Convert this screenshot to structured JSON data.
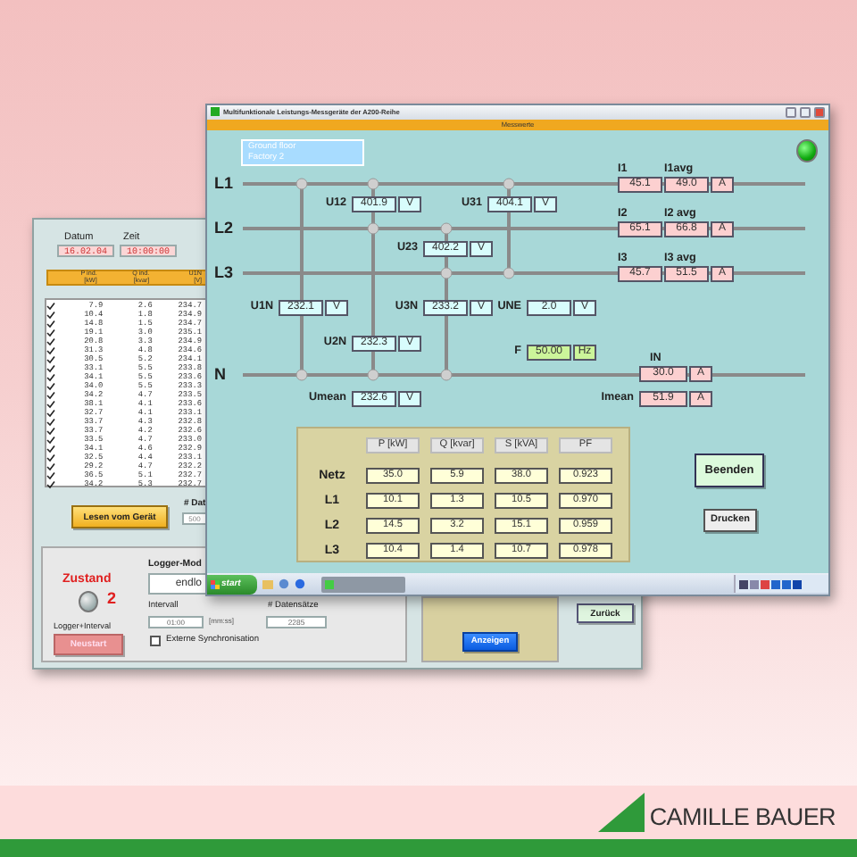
{
  "logger_window": {
    "date_label": "Datum",
    "time_label": "Zeit",
    "date": "16.02.04",
    "time": "10:00:00",
    "columns": [
      {
        "name": "P ind.",
        "unit": "[kW]"
      },
      {
        "name": "Q ind.",
        "unit": "[kvar]"
      },
      {
        "name": "U1N",
        "unit": "[V]"
      }
    ],
    "rows": [
      {
        "checked": true,
        "values": [
          "7.9",
          "2.6",
          "234.7"
        ]
      },
      {
        "checked": true,
        "values": [
          "10.4",
          "1.8",
          "234.9"
        ]
      },
      {
        "checked": true,
        "values": [
          "14.8",
          "1.5",
          "234.7"
        ]
      },
      {
        "checked": true,
        "values": [
          "19.1",
          "3.0",
          "235.1"
        ]
      },
      {
        "checked": true,
        "values": [
          "20.8",
          "3.3",
          "234.9"
        ]
      },
      {
        "checked": true,
        "values": [
          "31.3",
          "4.8",
          "234.6"
        ]
      },
      {
        "checked": true,
        "values": [
          "30.5",
          "5.2",
          "234.1"
        ]
      },
      {
        "checked": true,
        "values": [
          "33.1",
          "5.5",
          "233.8"
        ]
      },
      {
        "checked": true,
        "values": [
          "34.1",
          "5.5",
          "233.6"
        ]
      },
      {
        "checked": true,
        "values": [
          "34.0",
          "5.5",
          "233.3"
        ]
      },
      {
        "checked": true,
        "values": [
          "34.2",
          "4.7",
          "233.5"
        ]
      },
      {
        "checked": true,
        "values": [
          "38.1",
          "4.1",
          "233.6"
        ]
      },
      {
        "checked": true,
        "values": [
          "32.7",
          "4.1",
          "233.1"
        ]
      },
      {
        "checked": true,
        "values": [
          "33.7",
          "4.3",
          "232.8"
        ]
      },
      {
        "checked": true,
        "values": [
          "33.7",
          "4.2",
          "232.6"
        ]
      },
      {
        "checked": true,
        "values": [
          "33.5",
          "4.7",
          "233.0"
        ]
      },
      {
        "checked": true,
        "values": [
          "34.1",
          "4.6",
          "232.9"
        ]
      },
      {
        "checked": true,
        "values": [
          "32.5",
          "4.4",
          "233.1"
        ]
      },
      {
        "checked": true,
        "values": [
          "29.2",
          "4.7",
          "232.2"
        ]
      },
      {
        "checked": true,
        "values": [
          "36.5",
          "5.1",
          "232.7"
        ]
      },
      {
        "checked": true,
        "values": [
          "34.2",
          "5.3",
          "232.7"
        ]
      }
    ],
    "read_button": "Lesen vom Gerät",
    "records_label": "# Dat",
    "records_value": "500",
    "status_label": "Zustand",
    "status_value": "2",
    "status_led_on": false,
    "restart_label": "Logger+Interval",
    "restart_button": "Neustart",
    "mode_label": "Logger-Mod",
    "mode_value": "endlo",
    "interval_label": "Intervall",
    "interval_value": "01:00",
    "interval_unit": "[mm:ss]",
    "count_label": "# Datensätze",
    "count_value": "2285",
    "sync": {
      "label": "Externe Synchronisation",
      "checked": false
    },
    "show_button": "Anzeigen",
    "back_button": "Zurück"
  },
  "measurement_window": {
    "title": "Multifunktionale Leistungs-Messgeräte der A200-Reihe",
    "section": "Messwerte",
    "location": [
      "Ground floor",
      "Factory 2"
    ],
    "led_on": true,
    "lines": [
      "L1",
      "L2",
      "L3",
      "N"
    ],
    "readings": [
      {
        "kind": "current_pair",
        "labels": [
          "I1",
          "I1avg"
        ],
        "values": [
          "45.1",
          "49.0"
        ],
        "unit": "A"
      },
      {
        "kind": "voltage",
        "label": "U12",
        "value": "401.9",
        "unit": "V"
      },
      {
        "kind": "voltage",
        "label": "U31",
        "value": "404.1",
        "unit": "V"
      },
      {
        "kind": "current_pair",
        "labels": [
          "I2",
          "I2 avg"
        ],
        "values": [
          "65.1",
          "66.8"
        ],
        "unit": "A"
      },
      {
        "kind": "voltage",
        "label": "U23",
        "value": "402.2",
        "unit": "V"
      },
      {
        "kind": "current_pair",
        "labels": [
          "I3",
          "I3 avg"
        ],
        "values": [
          "45.7",
          "51.5"
        ],
        "unit": "A"
      },
      {
        "kind": "voltage",
        "label": "U1N",
        "value": "232.1",
        "unit": "V"
      },
      {
        "kind": "voltage",
        "label": "U3N",
        "value": "233.2",
        "unit": "V"
      },
      {
        "kind": "voltage",
        "label": "UNE",
        "value": "2.0",
        "unit": "V"
      },
      {
        "kind": "voltage",
        "label": "U2N",
        "value": "232.3",
        "unit": "V"
      },
      {
        "kind": "frequency",
        "label": "F",
        "value": "50.00",
        "unit": "Hz"
      },
      {
        "kind": "current",
        "label": "IN",
        "value": "30.0",
        "unit": "A"
      },
      {
        "kind": "voltage",
        "label": "Umean",
        "value": "232.6",
        "unit": "V"
      },
      {
        "kind": "current_mean",
        "label": "Imean",
        "value": "51.9",
        "unit": "A"
      }
    ],
    "power_table": {
      "columns": [
        "P [kW]",
        "Q [kvar]",
        "S [kVA]",
        "PF"
      ],
      "rows": [
        {
          "label": "Netz",
          "values": [
            "35.0",
            "5.9",
            "38.0",
            "0.923"
          ]
        },
        {
          "label": "L1",
          "values": [
            "10.1",
            "1.3",
            "10.5",
            "0.970"
          ]
        },
        {
          "label": "L2",
          "values": [
            "14.5",
            "3.2",
            "15.1",
            "0.959"
          ]
        },
        {
          "label": "L3",
          "values": [
            "10.4",
            "1.4",
            "10.7",
            "0.978"
          ]
        }
      ]
    },
    "buttons": [
      "Beenden",
      "Drucken"
    ],
    "taskbar": {
      "start": "start"
    }
  },
  "brand": "CAMILLE BAUER"
}
